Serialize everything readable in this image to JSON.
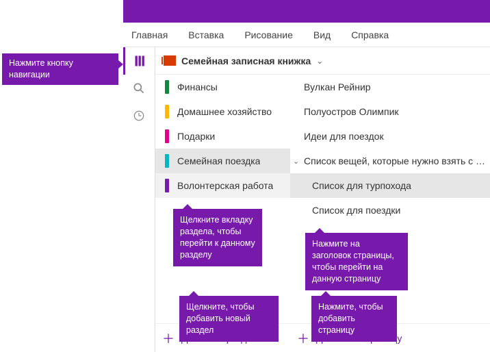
{
  "ribbon": {
    "tabs": [
      "Главная",
      "Вставка",
      "Рисование",
      "Вид",
      "Справка"
    ]
  },
  "notebook": {
    "title": "Семейная записная книжка"
  },
  "sections": [
    {
      "label": "Финансы",
      "color": "#10893e"
    },
    {
      "label": "Домашнее хозяйство",
      "color": "#ffb900"
    },
    {
      "label": "Подарки",
      "color": "#e3008c"
    },
    {
      "label": "Семейная поездка",
      "color": "#00b7c3"
    },
    {
      "label": "Волонтерская работа",
      "color": "#7719aa"
    }
  ],
  "pages": [
    {
      "label": "Вулкан Рейнир",
      "indent": 0,
      "chev": ""
    },
    {
      "label": "Полуостров Олимпик",
      "indent": 0,
      "chev": ""
    },
    {
      "label": "Идеи для поездок",
      "indent": 0,
      "chev": ""
    },
    {
      "label": "Список вещей, которые нужно взять с собой",
      "indent": 0,
      "chev": "⌄"
    },
    {
      "label": "Список для турпохода",
      "indent": 1,
      "chev": ""
    },
    {
      "label": "Список для поездки",
      "indent": 1,
      "chev": ""
    }
  ],
  "actions": {
    "add_section": "Добавить раздел",
    "add_page": "Добавить страницу"
  },
  "coachmarks": {
    "nav_button": "Нажмите кнопку навигации",
    "section_tab": "Щелкните вкладку раздела, чтобы перейти к данному разделу",
    "page_title": "Нажмите на заголовок страницы, чтобы перейти на данную страницу",
    "add_section": "Щелкните, чтобы добавить новый раздел",
    "add_page": "Нажмите, чтобы добавить страницу"
  }
}
